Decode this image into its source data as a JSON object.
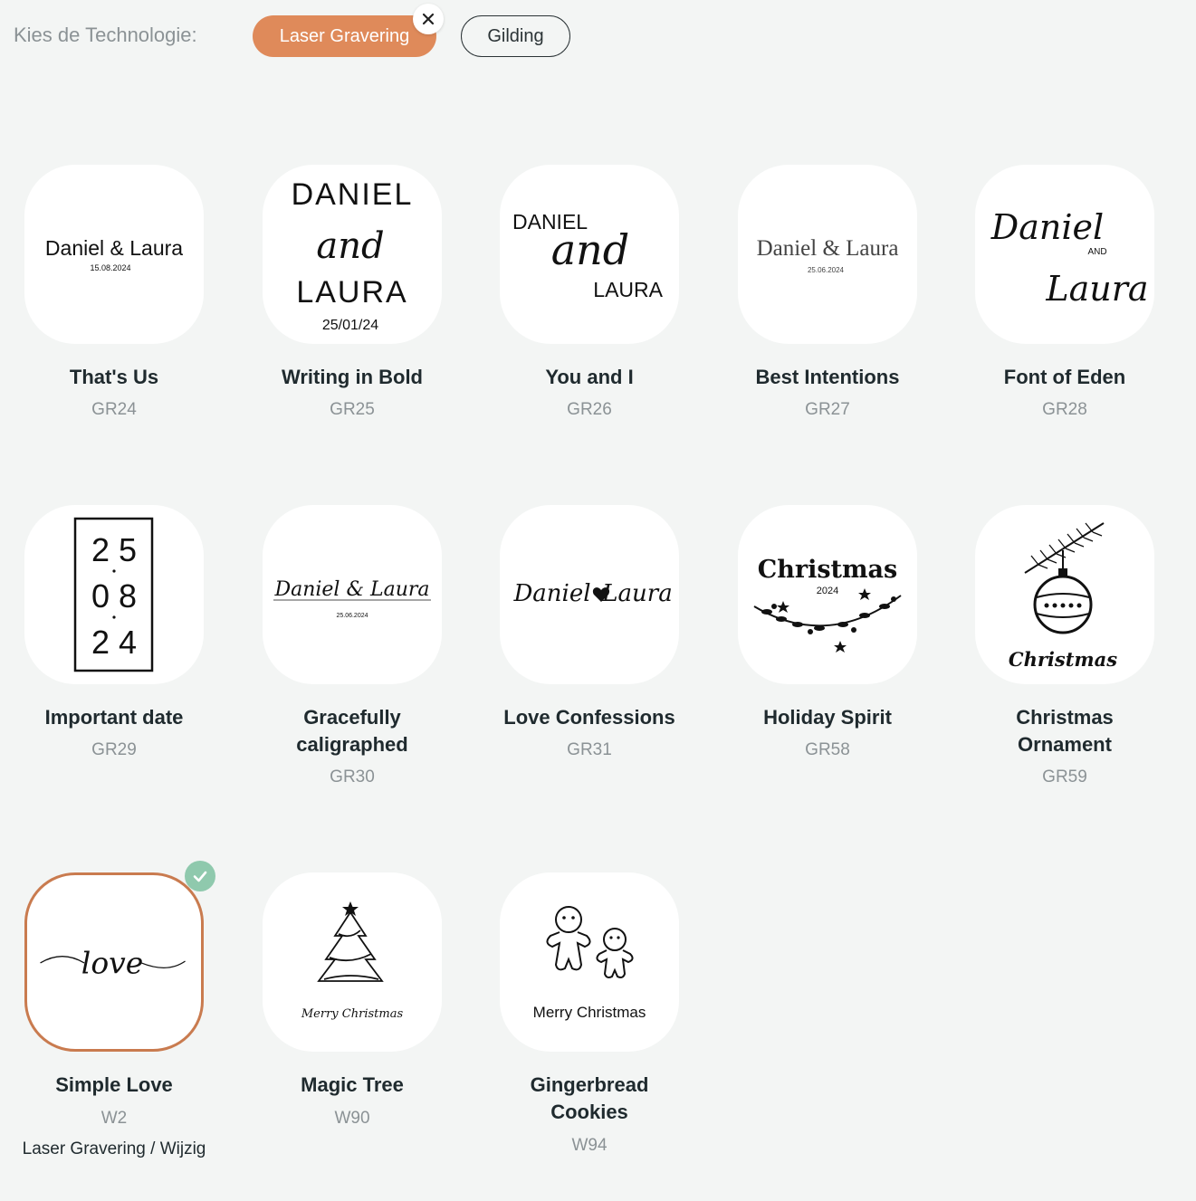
{
  "filter": {
    "label": "Kies de Technologie:",
    "options": [
      "Laser Gravering",
      "Gilding"
    ],
    "active": "Laser Gravering",
    "active_color": "#df8a5a",
    "close_icon": "close-icon"
  },
  "designs": [
    {
      "title": "That's Us",
      "code": "GR24",
      "preview": {
        "line1": "Daniel & Laura",
        "date": "15.08.2024"
      }
    },
    {
      "title": "Writing in Bold",
      "code": "GR25",
      "preview": {
        "line1": "DANIEL",
        "script": "and",
        "line2": "LAURA",
        "date": "25/01/24"
      }
    },
    {
      "title": "You and I",
      "code": "GR26",
      "preview": {
        "line1": "DANIEL",
        "script": "and",
        "line2": "LAURA"
      }
    },
    {
      "title": "Best Intentions",
      "code": "GR27",
      "preview": {
        "line1": "Daniel & Laura",
        "date": "25.06.2024"
      }
    },
    {
      "title": "Font of Eden",
      "code": "GR28",
      "preview": {
        "script1": "Daniel",
        "small": "AND",
        "script2": "Laura"
      }
    },
    {
      "title": "Important date",
      "code": "GR29",
      "preview": {
        "row1": "2 5",
        "row2": "0 8",
        "row3": "2 4"
      }
    },
    {
      "title": "Gracefully caligraphed",
      "code": "GR30",
      "preview": {
        "script": "Daniel & Laura",
        "date": "25.06.2024"
      }
    },
    {
      "title": "Love Confessions",
      "code": "GR31",
      "preview": {
        "script1": "Daniel",
        "script2": "Laura"
      }
    },
    {
      "title": "Holiday Spirit",
      "code": "GR58",
      "preview": {
        "heading": "Christmas",
        "year": "2024"
      }
    },
    {
      "title": "Christmas Ornament",
      "code": "GR59",
      "preview": {
        "script": "Christmas"
      }
    },
    {
      "title": "Simple Love",
      "code": "W2",
      "selected": true,
      "extra": "Laser Gravering / Wijzig",
      "preview": {
        "script": "love"
      }
    },
    {
      "title": "Magic Tree",
      "code": "W90",
      "preview": {
        "caption": "Merry Christmas"
      }
    },
    {
      "title": "Gingerbread Cookies",
      "code": "W94",
      "preview": {
        "caption": "Merry Christmas"
      }
    }
  ],
  "selection": {
    "badge_color": "#8fc9ad",
    "icon": "check-icon",
    "border_color": "#c97b4f"
  }
}
